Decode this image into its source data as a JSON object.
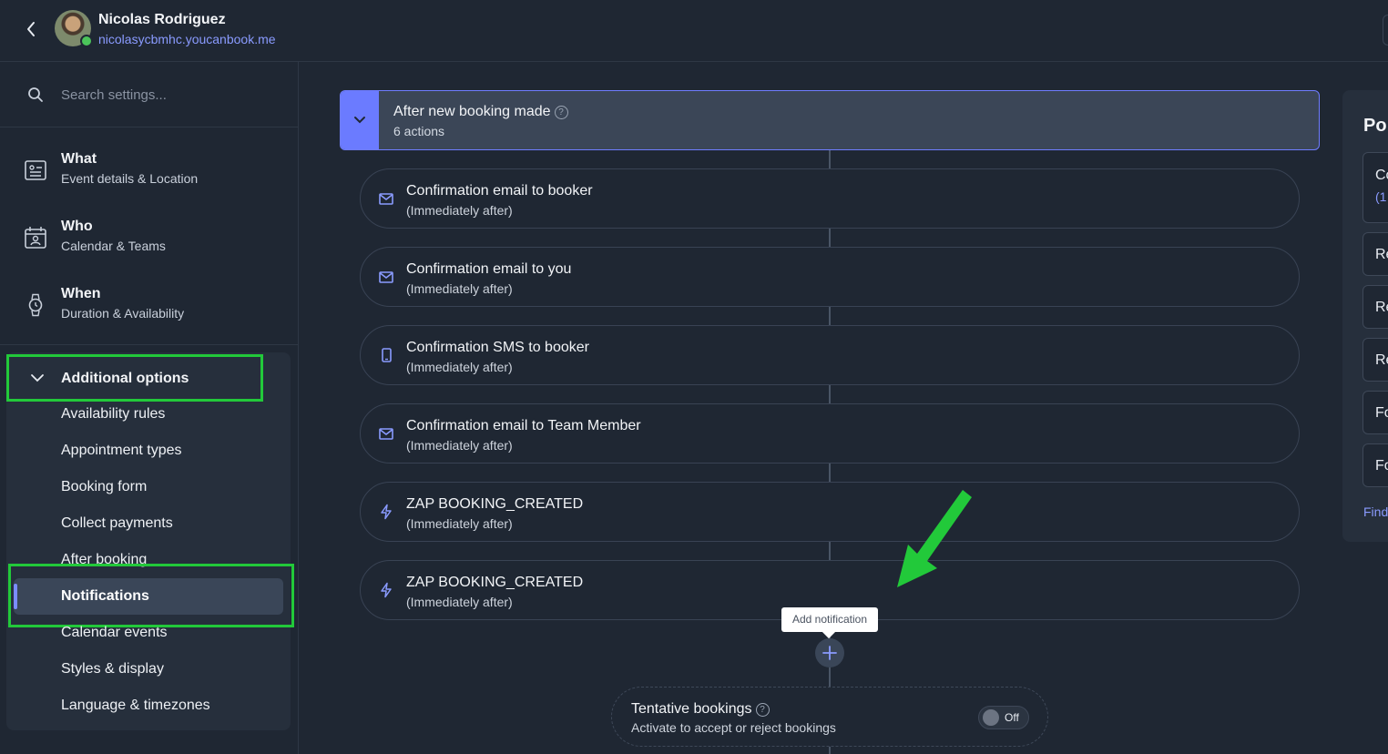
{
  "header": {
    "user_name": "Nicolas Rodriguez",
    "user_link": "nicolasycbmhc.youcanbook.me"
  },
  "sidebar": {
    "search_placeholder": "Search settings...",
    "nav": [
      {
        "title": "What",
        "subtitle": "Event details & Location",
        "icon": "document-icon"
      },
      {
        "title": "Who",
        "subtitle": "Calendar & Teams",
        "icon": "calendar-person-icon"
      },
      {
        "title": "When",
        "subtitle": "Duration & Availability",
        "icon": "watch-icon"
      }
    ],
    "additional": {
      "title": "Additional options",
      "items": [
        "Availability rules",
        "Appointment types",
        "Booking form",
        "Collect payments",
        "After booking",
        "Notifications",
        "Calendar events",
        "Styles & display",
        "Language & timezones"
      ],
      "active": "Notifications"
    }
  },
  "workflow": {
    "trigger": {
      "title": "After new booking made",
      "subtitle": "6 actions",
      "help": "?"
    },
    "actions": [
      {
        "title": "Confirmation email to booker",
        "timing": "(Immediately after)",
        "icon": "mail-icon"
      },
      {
        "title": "Confirmation email to you",
        "timing": "(Immediately after)",
        "icon": "mail-icon"
      },
      {
        "title": "Confirmation SMS to booker",
        "timing": "(Immediately after)",
        "icon": "phone-icon"
      },
      {
        "title": "Confirmation email to Team Member",
        "timing": "(Immediately after)",
        "icon": "mail-icon"
      },
      {
        "title": "ZAP BOOKING_CREATED",
        "timing": "(Immediately after)",
        "icon": "bolt-icon"
      },
      {
        "title": "ZAP BOOKING_CREATED",
        "timing": "(Immediately after)",
        "icon": "bolt-icon"
      }
    ],
    "add_tooltip": "Add notification",
    "tentative": {
      "title": "Tentative bookings",
      "help": "?",
      "subtitle": "Activate to accept or reject bookings",
      "toggle_label": "Off"
    }
  },
  "right_panel": {
    "title": "Po",
    "cards": [
      "Co",
      "Re",
      "Re",
      "Re",
      "Fo",
      "Fo"
    ],
    "card_sub": "(1",
    "link": "Find"
  },
  "colors": {
    "background": "#1f2733",
    "accent": "#6b7bff",
    "highlight_outline": "#22c93a",
    "link": "#8a9bff"
  }
}
